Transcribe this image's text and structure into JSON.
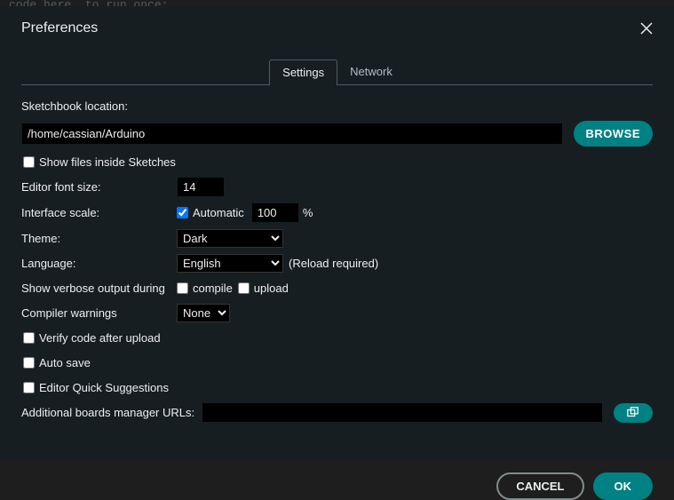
{
  "bg_text": "code here, to run once:",
  "title": "Preferences",
  "tabs": {
    "settings": "Settings",
    "network": "Network"
  },
  "labels": {
    "sketchbook": "Sketchbook location:",
    "show_files": "Show files inside Sketches",
    "font_size": "Editor font size:",
    "iface_scale": "Interface scale:",
    "automatic": "Automatic",
    "percent": "%",
    "theme": "Theme:",
    "language": "Language:",
    "reload_req": "(Reload required)",
    "verbose": "Show verbose output during",
    "compile": "compile",
    "upload": "upload",
    "compiler_warn": "Compiler warnings",
    "verify_after": "Verify code after upload",
    "auto_save": "Auto save",
    "quick_sugg": "Editor Quick Suggestions",
    "boards_url": "Additional boards manager URLs:"
  },
  "values": {
    "sketchbook_path": "/home/cassian/Arduino",
    "font_size": "14",
    "iface_scale": "100",
    "theme": "Dark",
    "language": "English",
    "compiler_warn": "None",
    "boards_url": "",
    "automatic_checked": true,
    "show_files_checked": false,
    "compile_checked": false,
    "upload_checked": false,
    "verify_checked": false,
    "auto_save_checked": false,
    "quick_sugg_checked": false
  },
  "buttons": {
    "browse": "BROWSE",
    "cancel": "CANCEL",
    "ok": "OK"
  }
}
